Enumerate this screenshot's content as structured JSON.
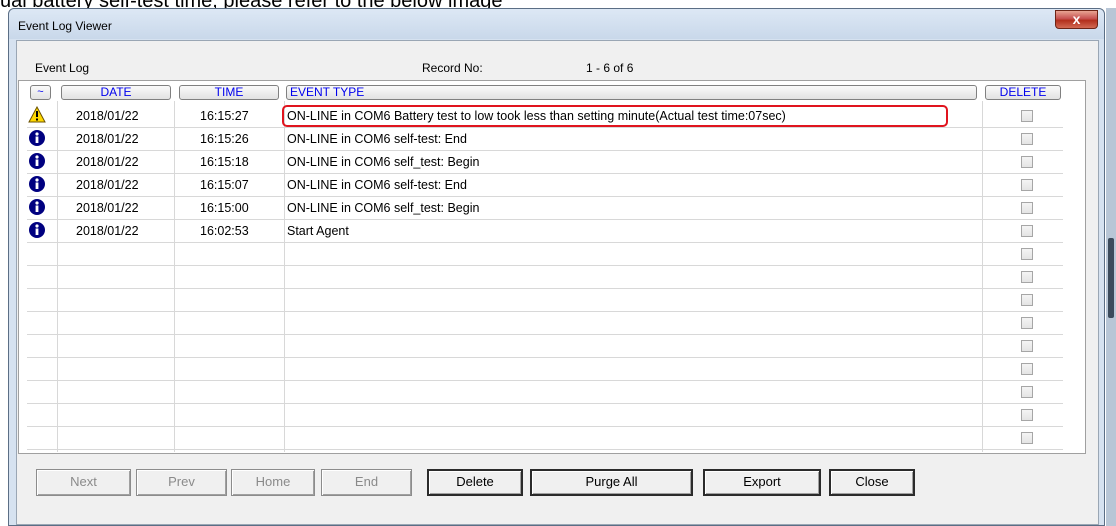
{
  "background_caption": "ual battery self-test time, please refer to the below image",
  "window": {
    "title": "Event Log Viewer",
    "close_label": "x"
  },
  "header": {
    "event_log_label": "Event Log",
    "record_no_label": "Record No:",
    "record_range": "1 - 6 of 6"
  },
  "columns": {
    "icon": "~",
    "date": "DATE",
    "time": "TIME",
    "event_type": "EVENT TYPE",
    "delete": "DELETE"
  },
  "events": [
    {
      "icon": "warning-icon",
      "date": "2018/01/22",
      "time": "16:15:27",
      "event_type": "ON-LINE in COM6 Battery test to low took less than setting minute(Actual test time:07sec)"
    },
    {
      "icon": "info-icon",
      "date": "2018/01/22",
      "time": "16:15:26",
      "event_type": "ON-LINE in COM6 self-test: End"
    },
    {
      "icon": "info-icon",
      "date": "2018/01/22",
      "time": "16:15:18",
      "event_type": "ON-LINE in COM6 self_test: Begin"
    },
    {
      "icon": "info-icon",
      "date": "2018/01/22",
      "time": "16:15:07",
      "event_type": "ON-LINE in COM6 self-test: End"
    },
    {
      "icon": "info-icon",
      "date": "2018/01/22",
      "time": "16:15:00",
      "event_type": "ON-LINE in COM6 self_test: Begin"
    },
    {
      "icon": "info-icon",
      "date": "2018/01/22",
      "time": "16:02:53",
      "event_type": "Start Agent"
    }
  ],
  "empty_row_count": 9,
  "buttons": {
    "next": "Next",
    "prev": "Prev",
    "home": "Home",
    "end": "End",
    "delete": "Delete",
    "purge_all": "Purge All",
    "export": "Export",
    "close": "Close"
  },
  "colors": {
    "header_link": "#0000ee",
    "highlight": "#e0141e",
    "warning": "#ffd800",
    "info": "#000080"
  }
}
